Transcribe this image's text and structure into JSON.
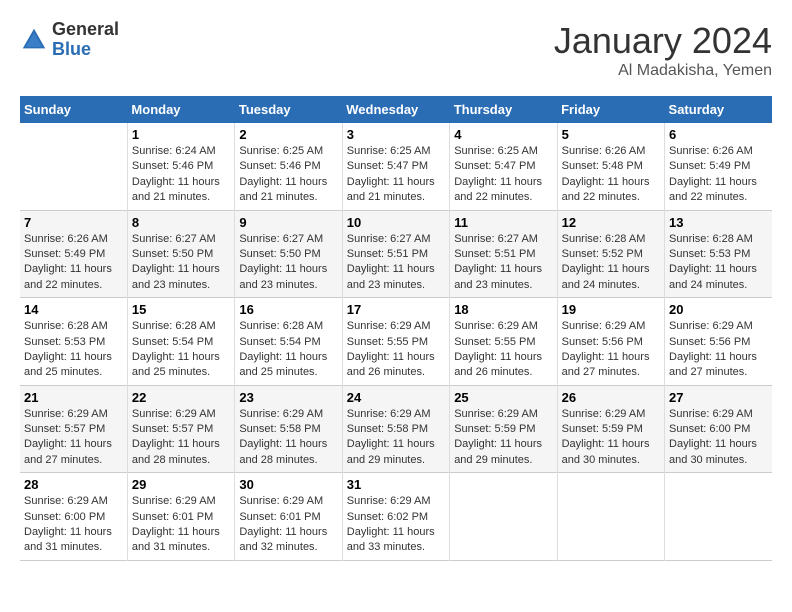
{
  "header": {
    "logo_general": "General",
    "logo_blue": "Blue",
    "month_title": "January 2024",
    "location": "Al Madakisha, Yemen"
  },
  "days_of_week": [
    "Sunday",
    "Monday",
    "Tuesday",
    "Wednesday",
    "Thursday",
    "Friday",
    "Saturday"
  ],
  "weeks": [
    [
      {
        "day": "",
        "info": ""
      },
      {
        "day": "1",
        "info": "Sunrise: 6:24 AM\nSunset: 5:46 PM\nDaylight: 11 hours\nand 21 minutes."
      },
      {
        "day": "2",
        "info": "Sunrise: 6:25 AM\nSunset: 5:46 PM\nDaylight: 11 hours\nand 21 minutes."
      },
      {
        "day": "3",
        "info": "Sunrise: 6:25 AM\nSunset: 5:47 PM\nDaylight: 11 hours\nand 21 minutes."
      },
      {
        "day": "4",
        "info": "Sunrise: 6:25 AM\nSunset: 5:47 PM\nDaylight: 11 hours\nand 22 minutes."
      },
      {
        "day": "5",
        "info": "Sunrise: 6:26 AM\nSunset: 5:48 PM\nDaylight: 11 hours\nand 22 minutes."
      },
      {
        "day": "6",
        "info": "Sunrise: 6:26 AM\nSunset: 5:49 PM\nDaylight: 11 hours\nand 22 minutes."
      }
    ],
    [
      {
        "day": "7",
        "info": "Sunrise: 6:26 AM\nSunset: 5:49 PM\nDaylight: 11 hours\nand 22 minutes."
      },
      {
        "day": "8",
        "info": "Sunrise: 6:27 AM\nSunset: 5:50 PM\nDaylight: 11 hours\nand 23 minutes."
      },
      {
        "day": "9",
        "info": "Sunrise: 6:27 AM\nSunset: 5:50 PM\nDaylight: 11 hours\nand 23 minutes."
      },
      {
        "day": "10",
        "info": "Sunrise: 6:27 AM\nSunset: 5:51 PM\nDaylight: 11 hours\nand 23 minutes."
      },
      {
        "day": "11",
        "info": "Sunrise: 6:27 AM\nSunset: 5:51 PM\nDaylight: 11 hours\nand 23 minutes."
      },
      {
        "day": "12",
        "info": "Sunrise: 6:28 AM\nSunset: 5:52 PM\nDaylight: 11 hours\nand 24 minutes."
      },
      {
        "day": "13",
        "info": "Sunrise: 6:28 AM\nSunset: 5:53 PM\nDaylight: 11 hours\nand 24 minutes."
      }
    ],
    [
      {
        "day": "14",
        "info": "Sunrise: 6:28 AM\nSunset: 5:53 PM\nDaylight: 11 hours\nand 25 minutes."
      },
      {
        "day": "15",
        "info": "Sunrise: 6:28 AM\nSunset: 5:54 PM\nDaylight: 11 hours\nand 25 minutes."
      },
      {
        "day": "16",
        "info": "Sunrise: 6:28 AM\nSunset: 5:54 PM\nDaylight: 11 hours\nand 25 minutes."
      },
      {
        "day": "17",
        "info": "Sunrise: 6:29 AM\nSunset: 5:55 PM\nDaylight: 11 hours\nand 26 minutes."
      },
      {
        "day": "18",
        "info": "Sunrise: 6:29 AM\nSunset: 5:55 PM\nDaylight: 11 hours\nand 26 minutes."
      },
      {
        "day": "19",
        "info": "Sunrise: 6:29 AM\nSunset: 5:56 PM\nDaylight: 11 hours\nand 27 minutes."
      },
      {
        "day": "20",
        "info": "Sunrise: 6:29 AM\nSunset: 5:56 PM\nDaylight: 11 hours\nand 27 minutes."
      }
    ],
    [
      {
        "day": "21",
        "info": "Sunrise: 6:29 AM\nSunset: 5:57 PM\nDaylight: 11 hours\nand 27 minutes."
      },
      {
        "day": "22",
        "info": "Sunrise: 6:29 AM\nSunset: 5:57 PM\nDaylight: 11 hours\nand 28 minutes."
      },
      {
        "day": "23",
        "info": "Sunrise: 6:29 AM\nSunset: 5:58 PM\nDaylight: 11 hours\nand 28 minutes."
      },
      {
        "day": "24",
        "info": "Sunrise: 6:29 AM\nSunset: 5:58 PM\nDaylight: 11 hours\nand 29 minutes."
      },
      {
        "day": "25",
        "info": "Sunrise: 6:29 AM\nSunset: 5:59 PM\nDaylight: 11 hours\nand 29 minutes."
      },
      {
        "day": "26",
        "info": "Sunrise: 6:29 AM\nSunset: 5:59 PM\nDaylight: 11 hours\nand 30 minutes."
      },
      {
        "day": "27",
        "info": "Sunrise: 6:29 AM\nSunset: 6:00 PM\nDaylight: 11 hours\nand 30 minutes."
      }
    ],
    [
      {
        "day": "28",
        "info": "Sunrise: 6:29 AM\nSunset: 6:00 PM\nDaylight: 11 hours\nand 31 minutes."
      },
      {
        "day": "29",
        "info": "Sunrise: 6:29 AM\nSunset: 6:01 PM\nDaylight: 11 hours\nand 31 minutes."
      },
      {
        "day": "30",
        "info": "Sunrise: 6:29 AM\nSunset: 6:01 PM\nDaylight: 11 hours\nand 32 minutes."
      },
      {
        "day": "31",
        "info": "Sunrise: 6:29 AM\nSunset: 6:02 PM\nDaylight: 11 hours\nand 33 minutes."
      },
      {
        "day": "",
        "info": ""
      },
      {
        "day": "",
        "info": ""
      },
      {
        "day": "",
        "info": ""
      }
    ]
  ]
}
